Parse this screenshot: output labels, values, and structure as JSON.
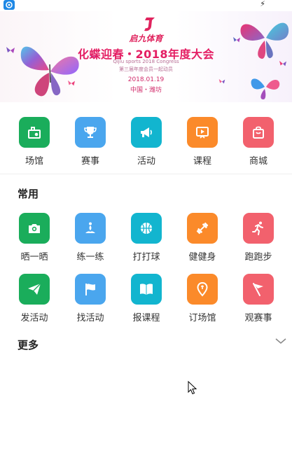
{
  "banner": {
    "logo_text": "启九体育",
    "title": "化蝶迎春・2018年度大会",
    "subtitle_en": "Qijiu sports 2018 Congress",
    "subtitle_cn": "第三届年度会员一起动员",
    "date": "2018.01.19",
    "location": "中国・潍坊"
  },
  "main_nav": [
    {
      "label": "场馆",
      "icon": "venue-icon",
      "color": "#1aad5b"
    },
    {
      "label": "赛事",
      "icon": "trophy-icon",
      "color": "#4aa6ee"
    },
    {
      "label": "活动",
      "icon": "megaphone-icon",
      "color": "#12b5cf"
    },
    {
      "label": "课程",
      "icon": "course-video-icon",
      "color": "#fb8a2a"
    },
    {
      "label": "商城",
      "icon": "shopping-bag-icon",
      "color": "#f2616d"
    }
  ],
  "common": {
    "title": "常用",
    "row1": [
      {
        "label": "晒一晒",
        "icon": "camera-icon",
        "color": "#1aad5b"
      },
      {
        "label": "练一练",
        "icon": "meditation-icon",
        "color": "#4aa6ee"
      },
      {
        "label": "打打球",
        "icon": "basketball-icon",
        "color": "#12b5cf"
      },
      {
        "label": "健健身",
        "icon": "dumbbell-icon",
        "color": "#fb8a2a"
      },
      {
        "label": "跑跑步",
        "icon": "runner-icon",
        "color": "#f2616d"
      }
    ],
    "row2": [
      {
        "label": "发活动",
        "icon": "paper-plane-icon",
        "color": "#1aad5b"
      },
      {
        "label": "找活动",
        "icon": "flag-icon",
        "color": "#4aa6ee"
      },
      {
        "label": "报课程",
        "icon": "book-icon",
        "color": "#12b5cf"
      },
      {
        "label": "订场馆",
        "icon": "location-pin-icon",
        "color": "#fb8a2a"
      },
      {
        "label": "观赛事",
        "icon": "pennant-icon",
        "color": "#f2616d"
      }
    ]
  },
  "more": {
    "title": "更多"
  }
}
